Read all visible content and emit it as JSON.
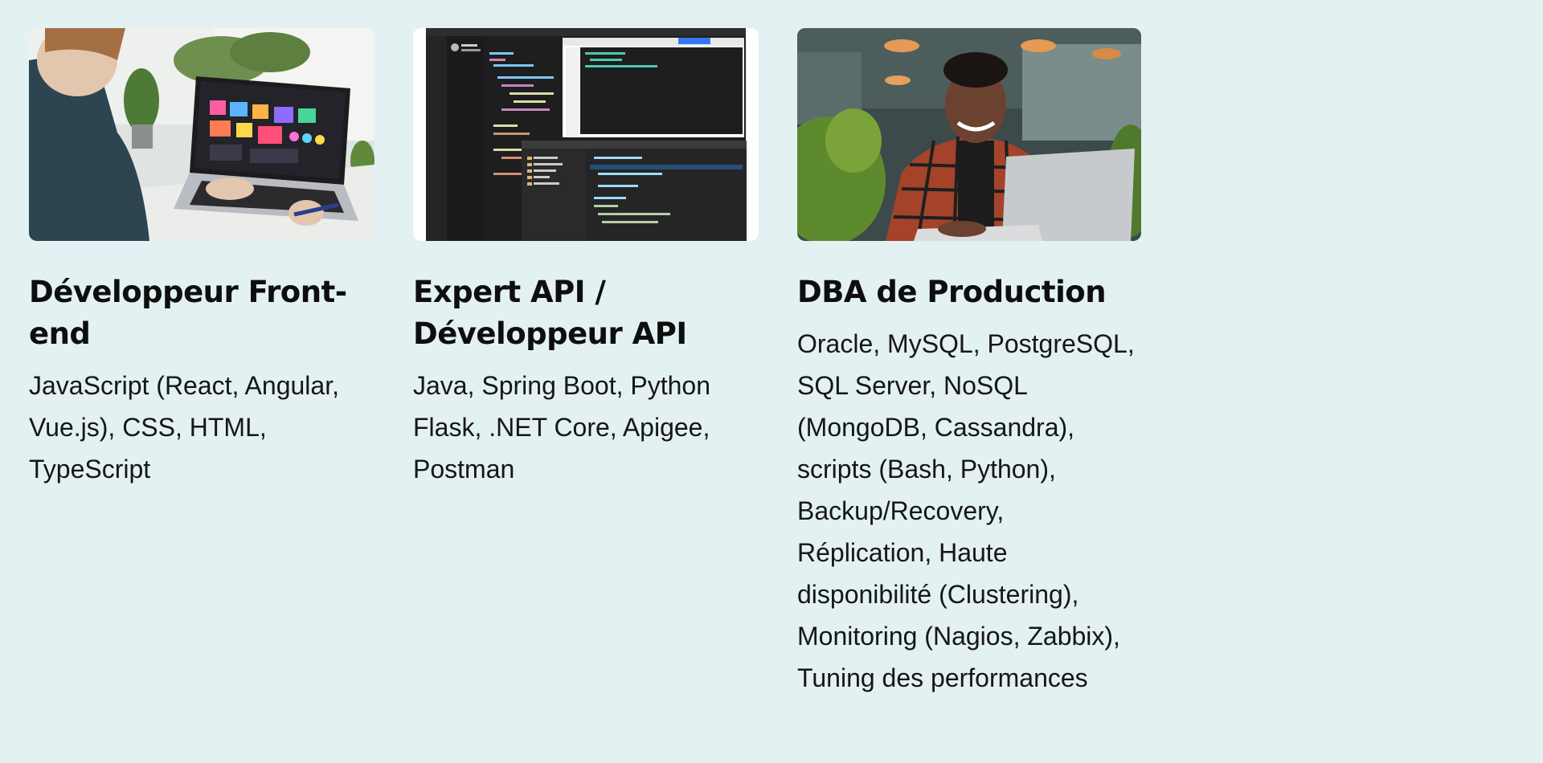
{
  "cards": [
    {
      "title": "Développeur Front-end",
      "description": "JavaScript (React, Angular, Vue.js), CSS, HTML, TypeScript",
      "image_icon": "laptop-dashboard-photo"
    },
    {
      "title": "Expert API / Développeur API",
      "description": "Java, Spring Boot, Python Flask, .NET Core, Apigee, Postman",
      "image_icon": "code-editor-screenshot"
    },
    {
      "title": "DBA de Production",
      "description": "Oracle, MySQL, PostgreSQL, SQL Server, NoSQL (MongoDB, Cassandra), scripts (Bash, Python), Backup/Recovery, Réplication, Haute disponibilité (Clustering), Monitoring (Nagios, Zabbix), Tuning des performances",
      "image_icon": "man-laptop-photo"
    }
  ],
  "colors": {
    "background": "#e3f1f3",
    "text": "#111111"
  }
}
